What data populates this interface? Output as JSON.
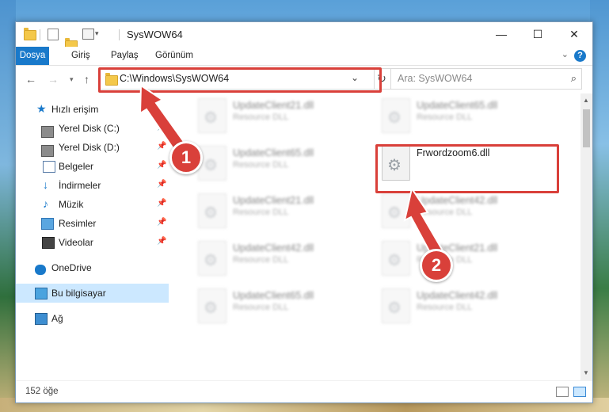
{
  "window": {
    "title": "SysWOW64",
    "minimize_glyph": "—",
    "maximize_glyph": "☐",
    "close_glyph": "✕"
  },
  "ribbon": {
    "tabs": [
      "Dosya",
      "Giriş",
      "Paylaş",
      "Görünüm"
    ],
    "active_tab": "Dosya",
    "help_glyph": "?"
  },
  "navigation": {
    "address": "C:\\Windows\\SysWOW64",
    "search_placeholder": "Ara: SysWOW64"
  },
  "sidebar": {
    "quick_access": "Hızlı erişim",
    "items": [
      {
        "label": "Yerel Disk (C:)",
        "icon": "drive-icon",
        "pinned": true
      },
      {
        "label": "Yerel Disk (D:)",
        "icon": "drive-icon",
        "pinned": true
      },
      {
        "label": "Belgeler",
        "icon": "documents-icon",
        "pinned": true
      },
      {
        "label": "İndirmeler",
        "icon": "downloads-icon",
        "pinned": true
      },
      {
        "label": "Müzik",
        "icon": "music-icon",
        "pinned": true
      },
      {
        "label": "Resimler",
        "icon": "pictures-icon",
        "pinned": true
      },
      {
        "label": "Videolar",
        "icon": "videos-icon",
        "pinned": true
      }
    ],
    "onedrive": "OneDrive",
    "this_pc": "Bu bilgisayar",
    "network": "Ağ"
  },
  "files": [
    {
      "name": "UpdateClient21.dll",
      "type": "Resource DLL",
      "blurred": true
    },
    {
      "name": "UpdateClient65.dll",
      "type": "Resource DLL",
      "blurred": true
    },
    {
      "name": "UpdateClient65.dll",
      "type": "Resource DLL",
      "blurred": true
    },
    {
      "name": "Frwordzoom6.dll",
      "type": "",
      "blurred": false,
      "highlighted": true
    },
    {
      "name": "UpdateClient21.dll",
      "type": "Resource DLL",
      "blurred": true
    },
    {
      "name": "UpdateClient42.dll",
      "type": "Resource DLL",
      "blurred": true
    },
    {
      "name": "UpdateClient42.dll",
      "type": "Resource DLL",
      "blurred": true
    },
    {
      "name": "UpdateClient21.dll",
      "type": "Resource DLL",
      "blurred": true
    },
    {
      "name": "UpdateClient65.dll",
      "type": "Resource DLL",
      "blurred": true
    },
    {
      "name": "UpdateClient42.dll",
      "type": "Resource DLL",
      "blurred": true
    }
  ],
  "status": {
    "item_count": "152 öğe"
  },
  "annotations": {
    "step1": "1",
    "step2": "2",
    "highlight_color": "#d9403a"
  }
}
